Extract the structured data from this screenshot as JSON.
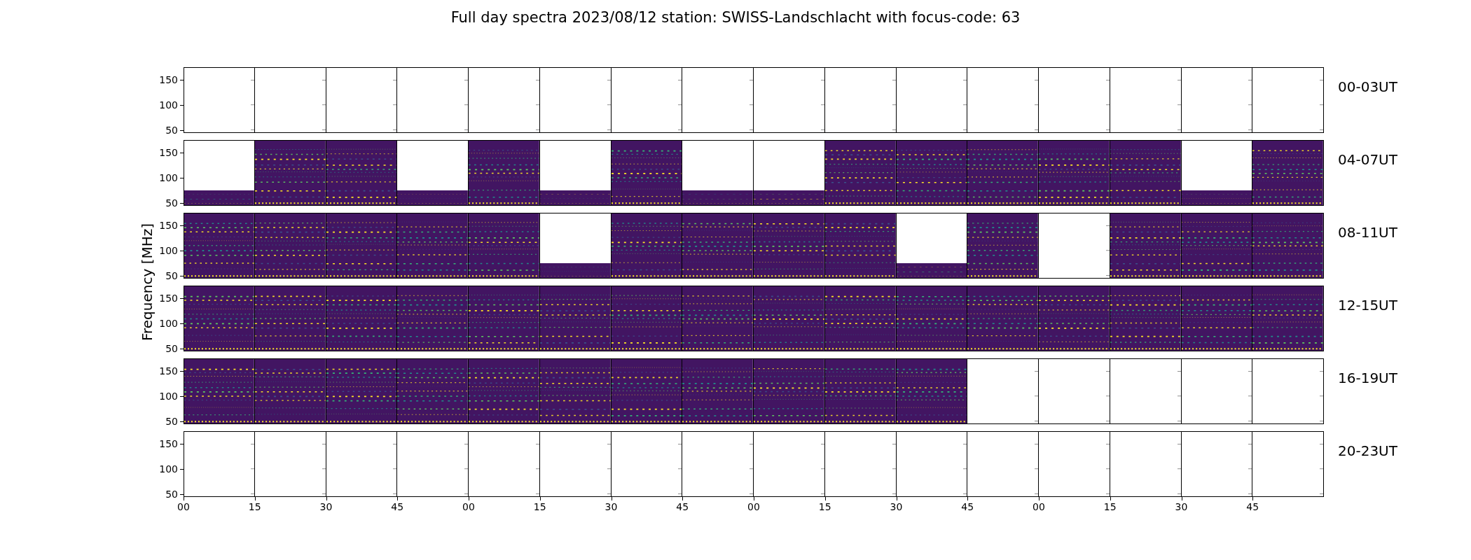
{
  "title": "Full day spectra 2023/08/12 station: SWISS-Landschlacht with focus-code: 63",
  "y_axis_label": "Frequency [MHz]",
  "x_ticks": [
    "00",
    "15",
    "30",
    "45",
    "00",
    "15",
    "30",
    "45",
    "00",
    "15",
    "30",
    "45",
    "00",
    "15",
    "30",
    "45"
  ],
  "rows": [
    {
      "label": "00-03UT",
      "y_ticks": [
        "150",
        "100",
        "50"
      ],
      "panels": [
        {
          "kind": "empty"
        },
        {
          "kind": "empty"
        },
        {
          "kind": "empty"
        },
        {
          "kind": "empty"
        },
        {
          "kind": "empty"
        },
        {
          "kind": "empty"
        },
        {
          "kind": "empty"
        },
        {
          "kind": "empty"
        },
        {
          "kind": "empty"
        },
        {
          "kind": "empty"
        },
        {
          "kind": "empty"
        },
        {
          "kind": "empty"
        },
        {
          "kind": "empty"
        },
        {
          "kind": "empty"
        },
        {
          "kind": "empty"
        },
        {
          "kind": "empty"
        }
      ]
    },
    {
      "label": "04-07UT",
      "y_ticks": [
        "150",
        "100",
        "50"
      ],
      "panels": [
        {
          "kind": "low"
        },
        {
          "kind": "full"
        },
        {
          "kind": "full"
        },
        {
          "kind": "low"
        },
        {
          "kind": "full"
        },
        {
          "kind": "low"
        },
        {
          "kind": "full"
        },
        {
          "kind": "low"
        },
        {
          "kind": "low"
        },
        {
          "kind": "full"
        },
        {
          "kind": "full"
        },
        {
          "kind": "full"
        },
        {
          "kind": "full"
        },
        {
          "kind": "full"
        },
        {
          "kind": "low"
        },
        {
          "kind": "full"
        }
      ]
    },
    {
      "label": "08-11UT",
      "y_ticks": [
        "150",
        "100",
        "50"
      ],
      "panels": [
        {
          "kind": "full"
        },
        {
          "kind": "full"
        },
        {
          "kind": "full"
        },
        {
          "kind": "full"
        },
        {
          "kind": "full"
        },
        {
          "kind": "low"
        },
        {
          "kind": "full"
        },
        {
          "kind": "full"
        },
        {
          "kind": "full"
        },
        {
          "kind": "full"
        },
        {
          "kind": "low"
        },
        {
          "kind": "full"
        },
        {
          "kind": "empty"
        },
        {
          "kind": "full"
        },
        {
          "kind": "full"
        },
        {
          "kind": "full"
        }
      ]
    },
    {
      "label": "12-15UT",
      "y_ticks": [
        "150",
        "100",
        "50"
      ],
      "panels": [
        {
          "kind": "full"
        },
        {
          "kind": "full"
        },
        {
          "kind": "full"
        },
        {
          "kind": "full"
        },
        {
          "kind": "full"
        },
        {
          "kind": "full"
        },
        {
          "kind": "full"
        },
        {
          "kind": "full"
        },
        {
          "kind": "full"
        },
        {
          "kind": "full"
        },
        {
          "kind": "full"
        },
        {
          "kind": "full"
        },
        {
          "kind": "full"
        },
        {
          "kind": "full"
        },
        {
          "kind": "full"
        },
        {
          "kind": "full"
        }
      ]
    },
    {
      "label": "16-19UT",
      "y_ticks": [
        "150",
        "100",
        "50"
      ],
      "panels": [
        {
          "kind": "full"
        },
        {
          "kind": "full"
        },
        {
          "kind": "full"
        },
        {
          "kind": "full"
        },
        {
          "kind": "full"
        },
        {
          "kind": "full"
        },
        {
          "kind": "full"
        },
        {
          "kind": "full"
        },
        {
          "kind": "full"
        },
        {
          "kind": "full"
        },
        {
          "kind": "full"
        },
        {
          "kind": "empty"
        },
        {
          "kind": "empty"
        },
        {
          "kind": "empty"
        },
        {
          "kind": "empty"
        },
        {
          "kind": "empty"
        }
      ]
    },
    {
      "label": "20-23UT",
      "y_ticks": [
        "150",
        "100",
        "50"
      ],
      "panels": [
        {
          "kind": "empty"
        },
        {
          "kind": "empty"
        },
        {
          "kind": "empty"
        },
        {
          "kind": "empty"
        },
        {
          "kind": "empty"
        },
        {
          "kind": "empty"
        },
        {
          "kind": "empty"
        },
        {
          "kind": "empty"
        },
        {
          "kind": "empty"
        },
        {
          "kind": "empty"
        },
        {
          "kind": "empty"
        },
        {
          "kind": "empty"
        },
        {
          "kind": "empty"
        },
        {
          "kind": "empty"
        },
        {
          "kind": "empty"
        },
        {
          "kind": "empty"
        }
      ]
    }
  ]
}
